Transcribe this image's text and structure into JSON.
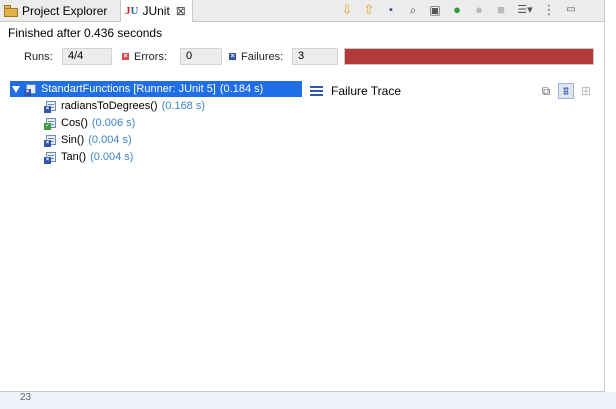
{
  "tabs": [
    {
      "label": "Project Explorer",
      "icon": "folder-icon"
    },
    {
      "label": "JUnit",
      "icon": "junit-icon"
    }
  ],
  "toolbar_icons": [
    "next-failure-icon",
    "previous-failure-icon",
    "show-failures-only-icon",
    "scroll-lock-icon",
    "history-icon",
    "rerun-icon",
    "rerun-failed-icon",
    "stop-icon",
    "layout-menu-icon",
    "view-menu-icon",
    "minimize-icon"
  ],
  "status": "Finished after 0.436 seconds",
  "counters": {
    "runs_label": "Runs:",
    "runs_value": "4/4",
    "errors_label": "Errors:",
    "errors_value": "0",
    "failures_label": "Failures:",
    "failures_value": "3"
  },
  "progress": {
    "fraction": 1.0,
    "color": "#b23a3a"
  },
  "tree": {
    "root": {
      "name": "StandartFunctions [Runner: JUnit 5]",
      "time": "(0.184 s)",
      "status": "failed"
    },
    "children": [
      {
        "name": "radiansToDegrees()",
        "time": "(0.168 s)",
        "status": "failed"
      },
      {
        "name": "Cos()",
        "time": "(0.006 s)",
        "status": "passed"
      },
      {
        "name": "Sin()",
        "time": "(0.004 s)",
        "status": "failed"
      },
      {
        "name": "Tan()",
        "time": "(0.004 s)",
        "status": "failed"
      }
    ]
  },
  "trace": {
    "title": "Failure Trace"
  },
  "bottom_line_number": "23",
  "colors": {
    "selection": "#1f6ee6",
    "failure_bar": "#b23a3a",
    "time_text": "#3f86c6"
  }
}
